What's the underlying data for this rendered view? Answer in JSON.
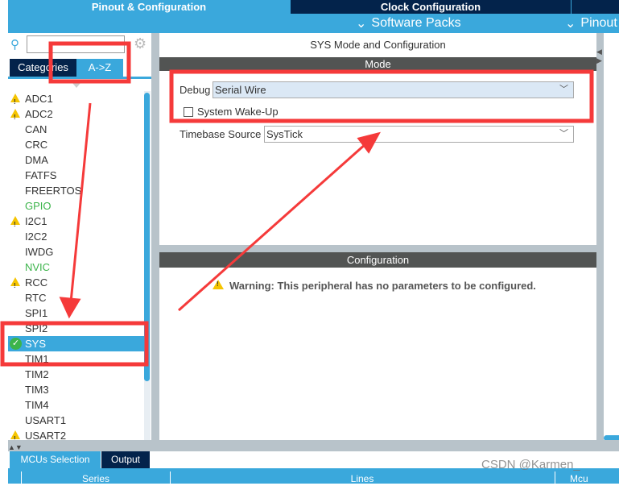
{
  "top_tabs": [
    {
      "label": "Pinout & Configuration",
      "active": true
    },
    {
      "label": "Clock Configuration",
      "active": false
    }
  ],
  "sub_tabs": [
    {
      "label": "Software Packs"
    },
    {
      "label": "Pinout"
    }
  ],
  "left": {
    "search": {
      "value": "",
      "placeholder": ""
    },
    "tabs": [
      {
        "label": "Categories"
      },
      {
        "label": "A->Z",
        "active": true
      }
    ],
    "items": [
      {
        "label": "ADC1",
        "status": "warning"
      },
      {
        "label": "ADC2",
        "status": "warning"
      },
      {
        "label": "CAN"
      },
      {
        "label": "CRC"
      },
      {
        "label": "DMA"
      },
      {
        "label": "FATFS"
      },
      {
        "label": "FREERTOS"
      },
      {
        "label": "GPIO",
        "status": "configured-green"
      },
      {
        "label": "I2C1",
        "status": "warning"
      },
      {
        "label": "I2C2"
      },
      {
        "label": "IWDG"
      },
      {
        "label": "NVIC",
        "status": "configured-green"
      },
      {
        "label": "RCC",
        "status": "warning"
      },
      {
        "label": "RTC"
      },
      {
        "label": "SPI1"
      },
      {
        "label": "SPI2"
      },
      {
        "label": "SYS",
        "status": "ok",
        "selected": true
      },
      {
        "label": "TIM1"
      },
      {
        "label": "TIM2"
      },
      {
        "label": "TIM3"
      },
      {
        "label": "TIM4"
      },
      {
        "label": "USART1"
      },
      {
        "label": "USART2",
        "status": "warning"
      }
    ]
  },
  "main": {
    "title": "SYS Mode and Configuration",
    "mode_header": "Mode",
    "debug_label": "Debug",
    "debug_value": "Serial Wire",
    "wakeup_label": "System Wake-Up",
    "wakeup_checked": false,
    "timebase_label": "Timebase Source",
    "timebase_value": "SysTick",
    "config_header": "Configuration",
    "warning": "Warning: This peripheral has no parameters to be configured."
  },
  "bottom": {
    "tabs": [
      {
        "label": "MCUs Selection",
        "active": true
      },
      {
        "label": "Output"
      }
    ],
    "columns": [
      "Series",
      "Lines",
      "Mcu"
    ]
  },
  "watermark": "CSDN @Karmen_",
  "colors": {
    "accent": "#3aa8dc",
    "navy": "#03234b",
    "header": "#525453",
    "annotation": "#f53a3a"
  }
}
